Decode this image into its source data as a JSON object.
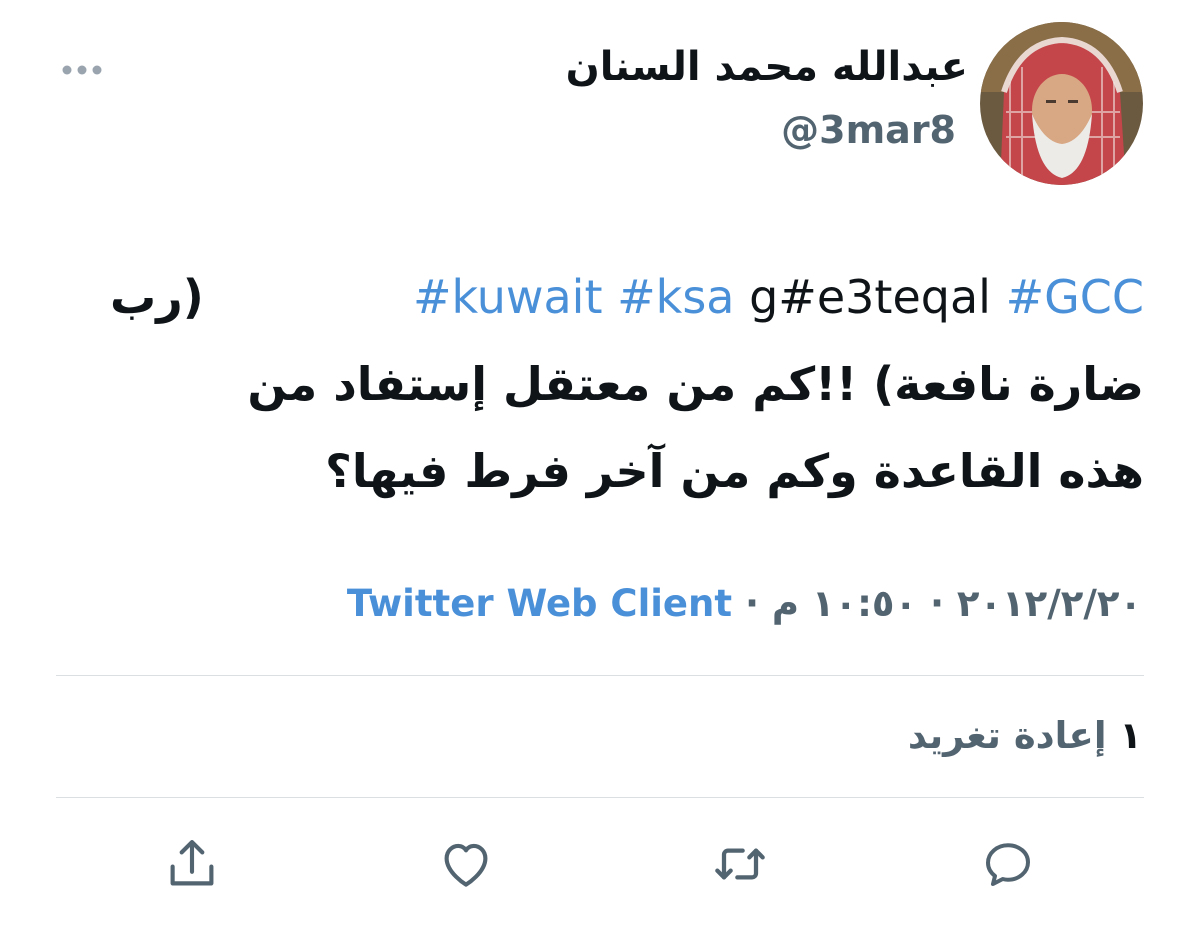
{
  "tweet": {
    "author": {
      "display_name": "عبدالله محمد السنان",
      "handle": "@3mar8",
      "avatar_icon": "user-avatar"
    },
    "text": {
      "segments": [
        {
          "type": "hashtag",
          "text": "#GCC"
        },
        {
          "type": "plain",
          "text": " "
        },
        {
          "type": "plain",
          "text": "g#e3teqal"
        },
        {
          "type": "plain",
          "text": " "
        },
        {
          "type": "hashtag",
          "text": "#ksa"
        },
        {
          "type": "plain",
          "text": " "
        },
        {
          "type": "hashtag",
          "text": "#kuwait"
        },
        {
          "type": "plain",
          "text": " (رب"
        }
      ],
      "line2": "ضارة نافعة) !!كم من معتقل إستفاد من",
      "line3": "هذه القاعدة وكم من آخر فرط فيها؟"
    },
    "meta": {
      "date": "٢٠١٢/٢/٢٠",
      "separator": "·",
      "time": "١٠:٥٠ م",
      "source": "Twitter Web Client"
    },
    "stats": {
      "retweet_count": "١",
      "retweet_label": "إعادة تغريد"
    },
    "actions": {
      "reply_icon": "reply-icon",
      "retweet_icon": "retweet-icon",
      "like_icon": "heart-icon",
      "share_icon": "share-icon",
      "more_icon": "more-dots-icon"
    },
    "colors": {
      "link": "#4a90d9",
      "secondary_text": "#536471",
      "primary_text": "#0f1419",
      "divider": "#dcdfe2"
    }
  }
}
